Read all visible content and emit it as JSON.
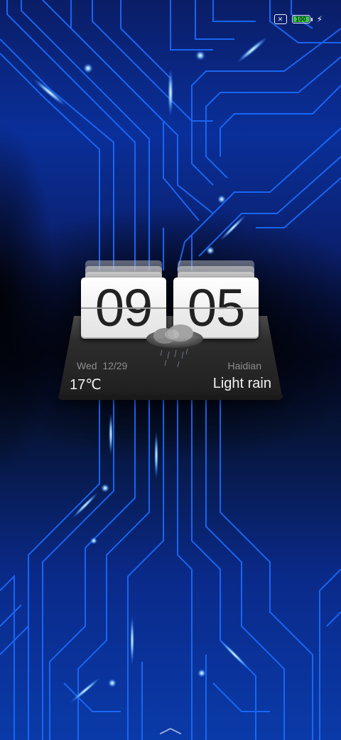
{
  "status_bar": {
    "sim_icon": "no-sim-icon",
    "sim_symbol": "✕",
    "battery_level": "100",
    "battery_fraction": 1.0,
    "battery_color": "#39d14a",
    "charging_icon": "charging-bolt-icon",
    "charging_symbol": "⚡"
  },
  "clock": {
    "hours": "09",
    "minutes": "05"
  },
  "weather": {
    "date": "Wed  12/29",
    "location": "Haidian",
    "temperature": "17℃",
    "condition": "Light rain",
    "icon": "rain-cloud-icon"
  },
  "wallpaper": {
    "theme": "blue-circuit-lines",
    "accent": "#1a6cff",
    "glow": "#8fd0ff"
  },
  "navigation": {
    "home_indicator": "chevron-up-icon"
  }
}
